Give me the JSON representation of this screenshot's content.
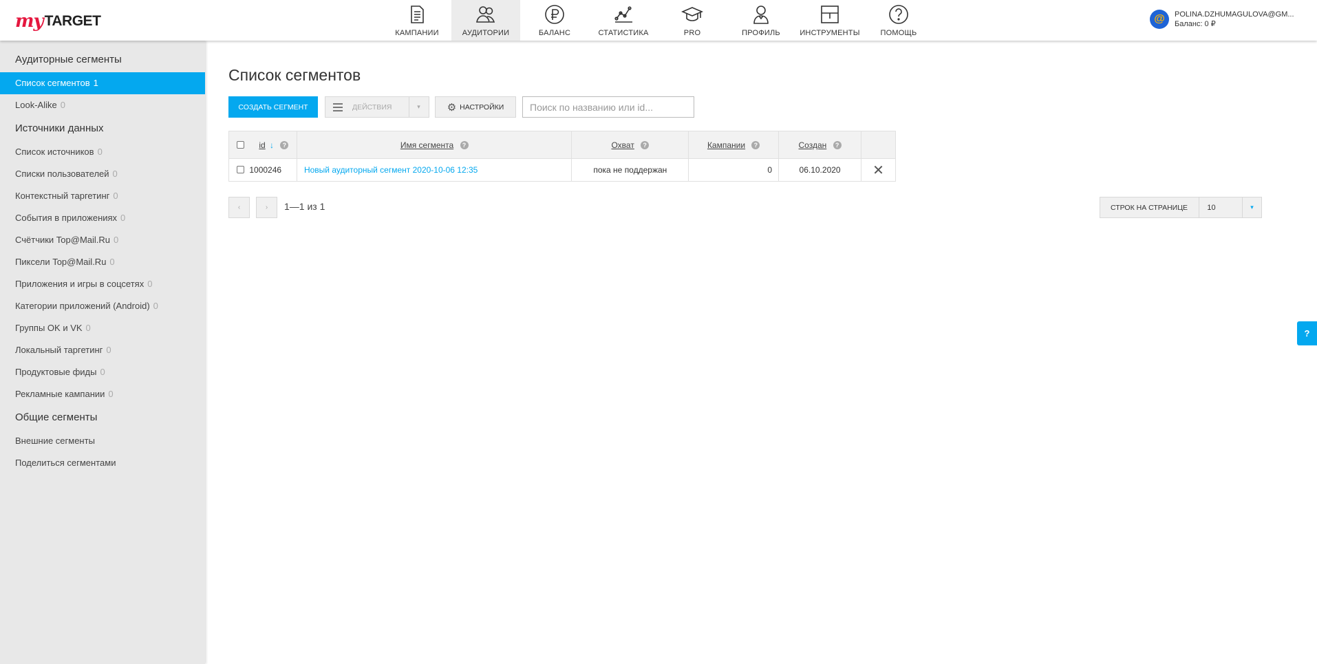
{
  "brand": {
    "my": "my",
    "target": "TARGET"
  },
  "nav": [
    {
      "label": "КАМПАНИИ"
    },
    {
      "label": "АУДИТОРИИ"
    },
    {
      "label": "БАЛАНС"
    },
    {
      "label": "СТАТИСТИКА"
    },
    {
      "label": "PRO"
    },
    {
      "label": "ПРОФИЛЬ"
    },
    {
      "label": "ИНСТРУМЕНТЫ"
    },
    {
      "label": "ПОМОЩЬ"
    }
  ],
  "account": {
    "email": "POLINA.DZHUMAGULOVA@GM...",
    "balance": "Баланс: 0 ₽"
  },
  "sidebar": {
    "section1": "Аудиторные сегменты",
    "section2": "Источники данных",
    "section3": "Общие сегменты",
    "items1": [
      {
        "label": "Список сегментов",
        "count": "1"
      },
      {
        "label": "Look-Alike",
        "count": "0"
      }
    ],
    "items2": [
      {
        "label": "Список источников",
        "count": "0"
      },
      {
        "label": "Списки пользователей",
        "count": "0"
      },
      {
        "label": "Контекстный таргетинг",
        "count": "0"
      },
      {
        "label": "События в приложениях",
        "count": "0"
      },
      {
        "label": "Счётчики Top@Mail.Ru",
        "count": "0"
      },
      {
        "label": "Пиксели Top@Mail.Ru",
        "count": "0"
      },
      {
        "label": "Приложения и игры в соцсетях",
        "count": "0"
      },
      {
        "label": "Категории приложений (Android)",
        "count": "0"
      },
      {
        "label": "Группы OK и VK",
        "count": "0"
      },
      {
        "label": "Локальный таргетинг",
        "count": "0"
      },
      {
        "label": "Продуктовые фиды",
        "count": "0"
      },
      {
        "label": "Рекламные кампании",
        "count": "0"
      }
    ],
    "items3": [
      {
        "label": "Внешние сегменты"
      },
      {
        "label": "Поделиться сегментами"
      }
    ]
  },
  "main": {
    "title": "Список сегментов",
    "create_label": "СОЗДАТЬ СЕГМЕНТ",
    "actions_label": "ДЕЙСТВИЯ",
    "settings_label": "НАСТРОЙКИ",
    "search_placeholder": "Поиск по названию или id..."
  },
  "table": {
    "columns": {
      "id": "id",
      "sort_arrow": "↓",
      "name": "Имя сегмента",
      "reach": "Охват",
      "campaigns": "Кампании",
      "created": "Создан",
      "help": "?"
    },
    "rows": [
      {
        "id": "1000246",
        "name": "Новый аудиторный сегмент 2020-10-06 12:35",
        "reach": "пока не поддержан",
        "campaigns": "0",
        "created": "06.10.2020"
      }
    ]
  },
  "pagination": {
    "prev": "‹",
    "next": "›",
    "info": "1—1 из 1",
    "rows_label": "СТРОК НА СТРАНИЦЕ",
    "rows_value": "10",
    "caret": "▾"
  },
  "help_tab": "?",
  "colors": {
    "accent": "#04a8ef",
    "brand": "#e5173f"
  }
}
